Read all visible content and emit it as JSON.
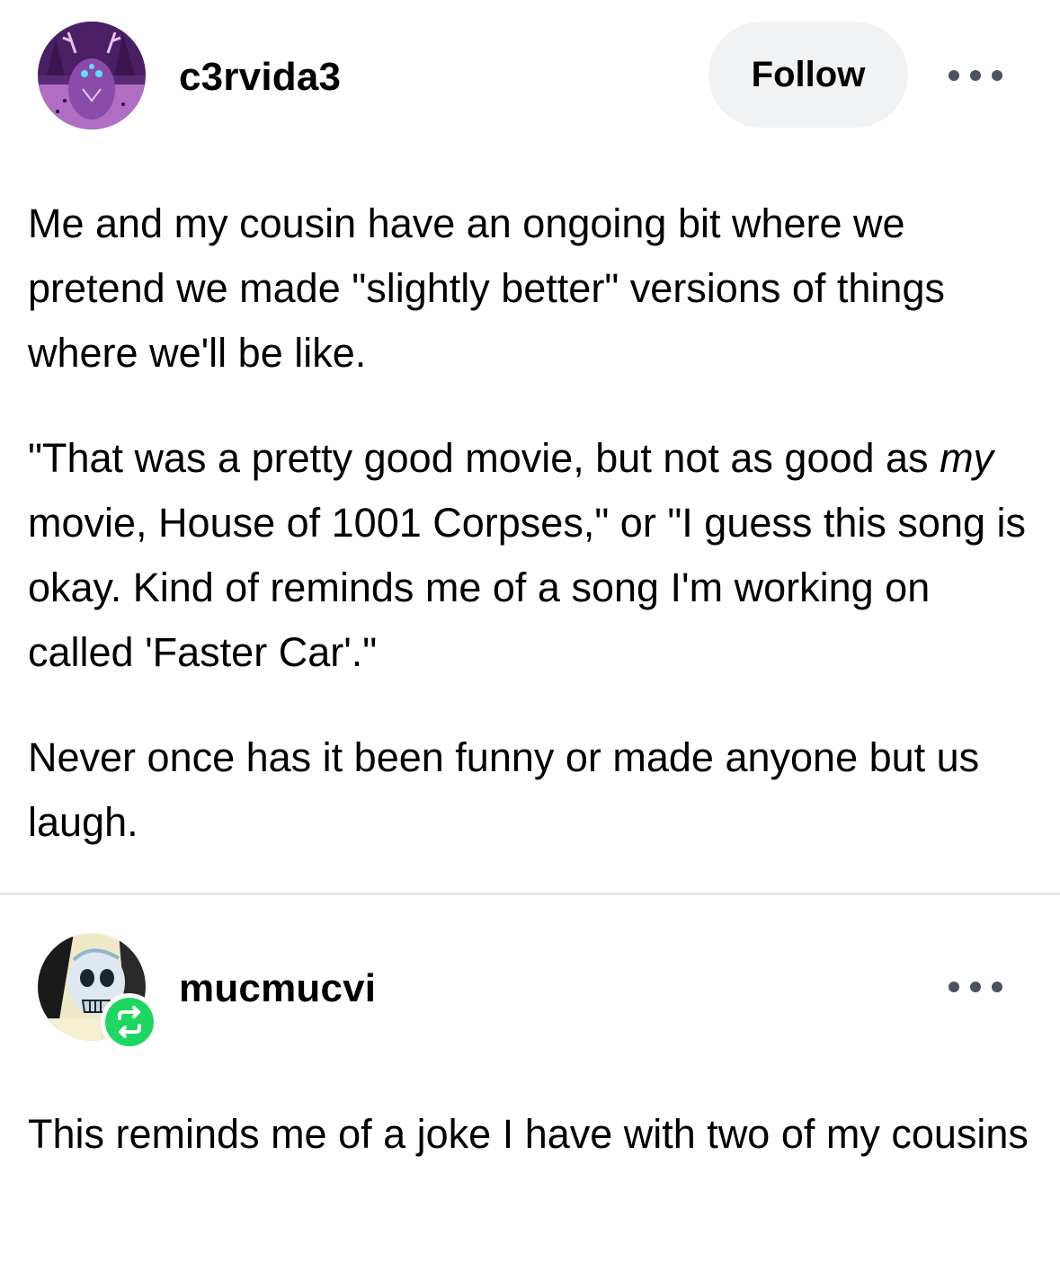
{
  "colors": {
    "follow_bg": "#f1f2f4",
    "reblog_green": "#1ed760",
    "divider": "#e4e5e8",
    "more_dots": "#4a5160"
  },
  "posts": [
    {
      "username": "c3rvida3",
      "avatar": "purple-deer-avatar",
      "follow_label": "Follow",
      "more_icon": "more-horizontal-icon",
      "paragraph_1": "Me and my cousin have an ongoing bit where we pretend we made \"slightly better\" versions of things where we'll be like.",
      "paragraph_2_em": "my",
      "paragraph_2_line_1": "\"That was a pretty good movie, but not as good as ",
      "paragraph_2_line_2": " movie, House of 1001 Corpses,\" or \"I guess this song is okay. Kind of reminds me of a song I'm working on called 'Faster Car'.\"",
      "paragraph_3": "Never once has it been funny or made anyone but us laugh."
    },
    {
      "username": "mucmucvi",
      "avatar": "skull-comic-avatar",
      "badge_icon": "reblog-icon",
      "more_icon": "more-horizontal-icon",
      "paragraph_1": "This reminds me of a joke I have with two of my cousins"
    }
  ]
}
